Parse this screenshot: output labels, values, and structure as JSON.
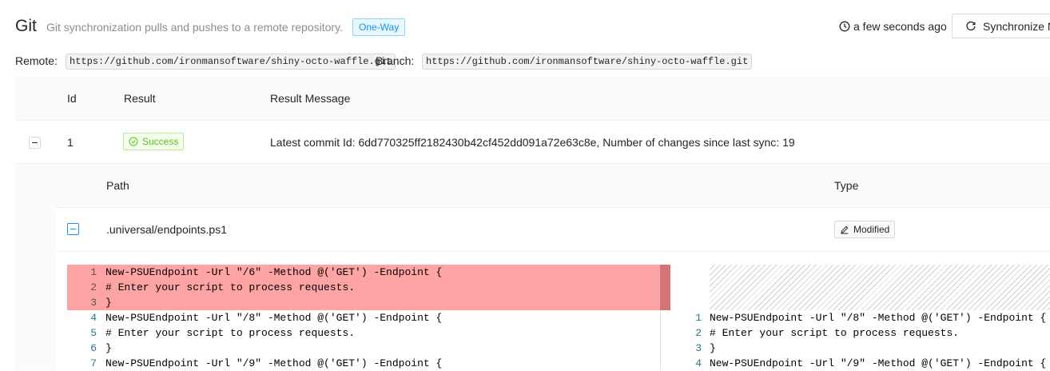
{
  "header": {
    "title": "Git",
    "subtitle": "Git synchronization pulls and pushes to a remote repository.",
    "mode_tag": "One-Way",
    "last_sync": "a few seconds ago",
    "sync_button": "Synchronize N"
  },
  "repo": {
    "remote_label": "Remote:",
    "remote_value": "https://github.com/ironmansoftware/shiny-octo-waffle.git",
    "branch_label": "Branch:",
    "branch_value": "https://github.com/ironmansoftware/shiny-octo-waffle.git"
  },
  "table": {
    "columns": [
      "Id",
      "Result",
      "Result Message"
    ],
    "rows": [
      {
        "id": "1",
        "result": "Success",
        "message": "Latest commit Id: 6dd770325ff2182430b42cf452dd091a72e63c8e, Number of changes since last sync: 19"
      }
    ]
  },
  "changes": {
    "columns": [
      "Path",
      "Type"
    ],
    "rows": [
      {
        "path": ".universal/endpoints.ps1",
        "type": "Modified"
      }
    ]
  },
  "diff": {
    "left": [
      {
        "n": "1",
        "text": "New-PSUEndpoint -Url \"/6\" -Method @('GET') -Endpoint {",
        "deleted": true
      },
      {
        "n": "2",
        "text": "# Enter your script to process requests.",
        "deleted": true
      },
      {
        "n": "3",
        "text": "}",
        "deleted": true
      },
      {
        "n": "4",
        "text": "New-PSUEndpoint -Url \"/8\" -Method @('GET') -Endpoint {",
        "deleted": false
      },
      {
        "n": "5",
        "text": "# Enter your script to process requests.",
        "deleted": false
      },
      {
        "n": "6",
        "text": "}",
        "deleted": false
      },
      {
        "n": "7",
        "text": "New-PSUEndpoint -Url \"/9\" -Method @('GET') -Endpoint {",
        "deleted": false
      }
    ],
    "right": [
      {
        "n": "1",
        "text": "New-PSUEndpoint -Url \"/8\" -Method @('GET') -Endpoint {"
      },
      {
        "n": "2",
        "text": "# Enter your script to process requests."
      },
      {
        "n": "3",
        "text": "}"
      },
      {
        "n": "4",
        "text": "New-PSUEndpoint -Url \"/9\" -Method @('GET') -Endpoint {"
      }
    ]
  },
  "colors": {
    "accent": "#1890ff",
    "success": "#52c41a",
    "deleted_line": "#ffa4a4"
  }
}
